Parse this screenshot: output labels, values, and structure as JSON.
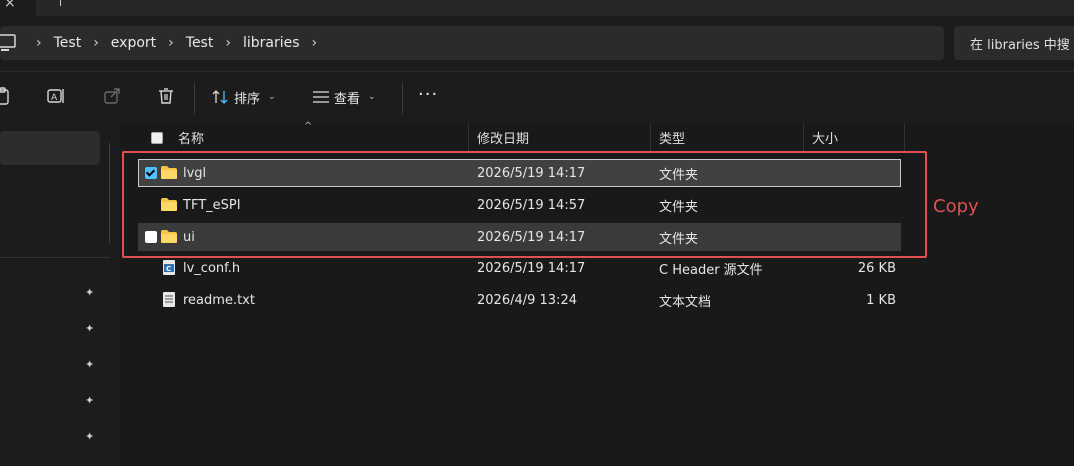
{
  "breadcrumbs": [
    "Test",
    "export",
    "Test",
    "libraries"
  ],
  "search": {
    "placeholder": "在 libraries 中搜"
  },
  "toolbar": {
    "sort_label": "排序",
    "view_label": "查看",
    "more_label": "···"
  },
  "columns": {
    "name": "名称",
    "modified": "修改日期",
    "type": "类型",
    "size": "大小"
  },
  "files": [
    {
      "name": "lvgl",
      "modified": "2026/5/19 14:17",
      "type": "文件夹",
      "size": "",
      "icon": "folder-icon",
      "checked": true,
      "state": "selected"
    },
    {
      "name": "TFT_eSPI",
      "modified": "2026/5/19 14:57",
      "type": "文件夹",
      "size": "",
      "icon": "folder-icon",
      "checked": false,
      "state": "normal"
    },
    {
      "name": "ui",
      "modified": "2026/5/19 14:17",
      "type": "文件夹",
      "size": "",
      "icon": "folder-icon",
      "checked": false,
      "state": "highlight"
    },
    {
      "name": "lv_conf.h",
      "modified": "2026/5/19 14:17",
      "type": "C Header 源文件",
      "size": "26 KB",
      "icon": "c-header-file-icon",
      "checked": false,
      "state": "normal"
    },
    {
      "name": "readme.txt",
      "modified": "2026/4/9 13:24",
      "type": "文本文档",
      "size": "1 KB",
      "icon": "text-file-icon",
      "checked": false,
      "state": "normal"
    }
  ],
  "annotation": {
    "label": "Copy",
    "color": "#e05050"
  },
  "colors": {
    "accent": "#4cc2ff",
    "folder": "#f4c542",
    "background": "#191919"
  }
}
